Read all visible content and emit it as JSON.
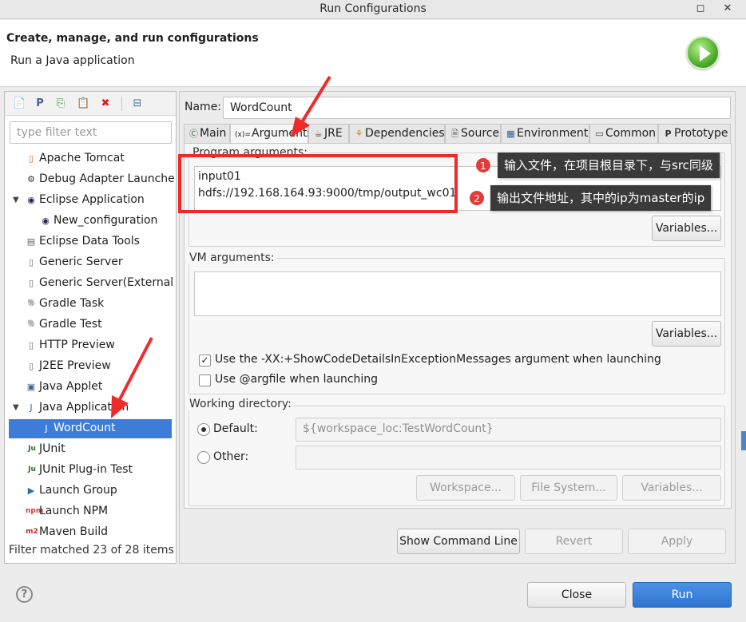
{
  "window": {
    "title": "Run Configurations",
    "restore_glyph": "◻",
    "close_glyph": "✕"
  },
  "header": {
    "title": "Create, manage, and run configurations",
    "subtitle": "Run a Java application",
    "logo_icon": "run-play-icon"
  },
  "sidebar": {
    "toolbar": [
      {
        "name": "new-configuration",
        "glyph": "📄"
      },
      {
        "name": "new-prototype",
        "glyph": "P"
      },
      {
        "name": "duplicate",
        "glyph": "⎘"
      },
      {
        "name": "export",
        "glyph": "📋"
      },
      {
        "name": "delete",
        "glyph": "✖"
      },
      {
        "name": "collapse-all",
        "glyph": "⊟"
      }
    ],
    "filter_placeholder": "type filter text",
    "items": [
      {
        "label": "Apache Tomcat",
        "icon": "tomcat-icon",
        "glyph": "▯",
        "color": "#c9741b"
      },
      {
        "label": "Debug Adapter Launcher",
        "icon": "debug-adapter-icon",
        "glyph": "⚙",
        "color": "#333333"
      },
      {
        "label": "Eclipse Application",
        "icon": "eclipse-icon",
        "glyph": "◉",
        "color": "#2c2255"
      },
      {
        "label": "New_configuration",
        "icon": "eclipse-icon",
        "glyph": "◉",
        "color": "#2c2255"
      },
      {
        "label": "Eclipse Data Tools",
        "icon": "database-icon",
        "glyph": "▤",
        "color": "#666666"
      },
      {
        "label": "Generic Server",
        "icon": "server-icon",
        "glyph": "▯",
        "color": "#6a6a6a"
      },
      {
        "label": "Generic Server(External La",
        "icon": "server-icon",
        "glyph": "▯",
        "color": "#6a6a6a"
      },
      {
        "label": "Gradle Task",
        "icon": "gradle-icon",
        "glyph": "🐘",
        "color": "#2f4f4f"
      },
      {
        "label": "Gradle Test",
        "icon": "gradle-icon",
        "glyph": "🐘",
        "color": "#2b8ea8"
      },
      {
        "label": "HTTP Preview",
        "icon": "http-icon",
        "glyph": "▯",
        "color": "#6a6a6a"
      },
      {
        "label": "J2EE Preview",
        "icon": "j2ee-icon",
        "glyph": "▯",
        "color": "#6a6a6a"
      },
      {
        "label": "Java Applet",
        "icon": "applet-icon",
        "glyph": "▣",
        "color": "#44608f"
      },
      {
        "label": "Java Application",
        "icon": "java-app-icon",
        "glyph": "J",
        "color": "#44608f"
      },
      {
        "label": "WordCount",
        "icon": "java-app-icon",
        "glyph": "J",
        "color": "#ffffff"
      },
      {
        "label": "JUnit",
        "icon": "junit-icon",
        "glyph": "Ju",
        "color": "#2e6b2e"
      },
      {
        "label": "JUnit Plug-in Test",
        "icon": "junit-plugin-icon",
        "glyph": "Ju",
        "color": "#2e6b2e"
      },
      {
        "label": "Launch Group",
        "icon": "launch-group-icon",
        "glyph": "▶",
        "color": "#2f6fad"
      },
      {
        "label": "Launch NPM",
        "icon": "npm-icon",
        "glyph": "npm",
        "color": "#cb3837"
      },
      {
        "label": "Maven Build",
        "icon": "maven-icon",
        "glyph": "m2",
        "color": "#c02727"
      }
    ],
    "filter_status": "Filter matched 23 of 28 items"
  },
  "config": {
    "name_label": "Name:",
    "name_value": "WordCount",
    "tabs": [
      {
        "label": "Main",
        "icon": "main-tab-icon",
        "glyph": "Ⓒ"
      },
      {
        "label": "Arguments",
        "icon": "arguments-tab-icon",
        "glyph": "(x)="
      },
      {
        "label": "JRE",
        "icon": "jre-tab-icon",
        "glyph": "☕"
      },
      {
        "label": "Dependencies",
        "icon": "dependencies-tab-icon",
        "glyph": "⚘"
      },
      {
        "label": "Source",
        "icon": "source-tab-icon",
        "glyph": "🗎"
      },
      {
        "label": "Environment",
        "icon": "environment-tab-icon",
        "glyph": "▦"
      },
      {
        "label": "Common",
        "icon": "common-tab-icon",
        "glyph": "▭"
      },
      {
        "label": "Prototype",
        "icon": "prototype-tab-icon",
        "glyph": "P"
      }
    ],
    "active_tab": "Arguments",
    "program_args": {
      "title": "Program arguments:",
      "lines": [
        "input01",
        "hdfs://192.168.164.93:9000/tmp/output_wc01"
      ],
      "variables_button": "Variables..."
    },
    "vm_args": {
      "title": "VM arguments:",
      "value": "",
      "variables_button": "Variables..."
    },
    "options": {
      "show_code_details": {
        "label": "Use the -XX:+ShowCodeDetailsInExceptionMessages argument when launching",
        "checked": true
      },
      "argfile": {
        "label": "Use @argfile when launching",
        "checked": false
      }
    },
    "working_dir": {
      "title": "Working directory:",
      "default_label": "Default:",
      "default_value": "${workspace_loc:TestWordCount}",
      "other_label": "Other:",
      "other_value": "",
      "workspace_button": "Workspace...",
      "filesystem_button": "File System...",
      "variables_button": "Variables..."
    },
    "buttons": {
      "show_command_line": "Show Command Line",
      "revert": "Revert",
      "apply": "Apply"
    }
  },
  "footer": {
    "help_glyph": "?",
    "close": "Close",
    "run": "Run"
  },
  "annotations": {
    "callout1": {
      "number": "1",
      "text": "输入文件，在项目根目录下，与src同级"
    },
    "callout2": {
      "number": "2",
      "text": "输出文件地址，其中的ip为master的ip"
    },
    "highlight_color": "#ef2a2a",
    "arrow_color": "#ef2a2a"
  },
  "colors": {
    "selection": "#3d7dd9",
    "run_button": "#2f74cf"
  }
}
